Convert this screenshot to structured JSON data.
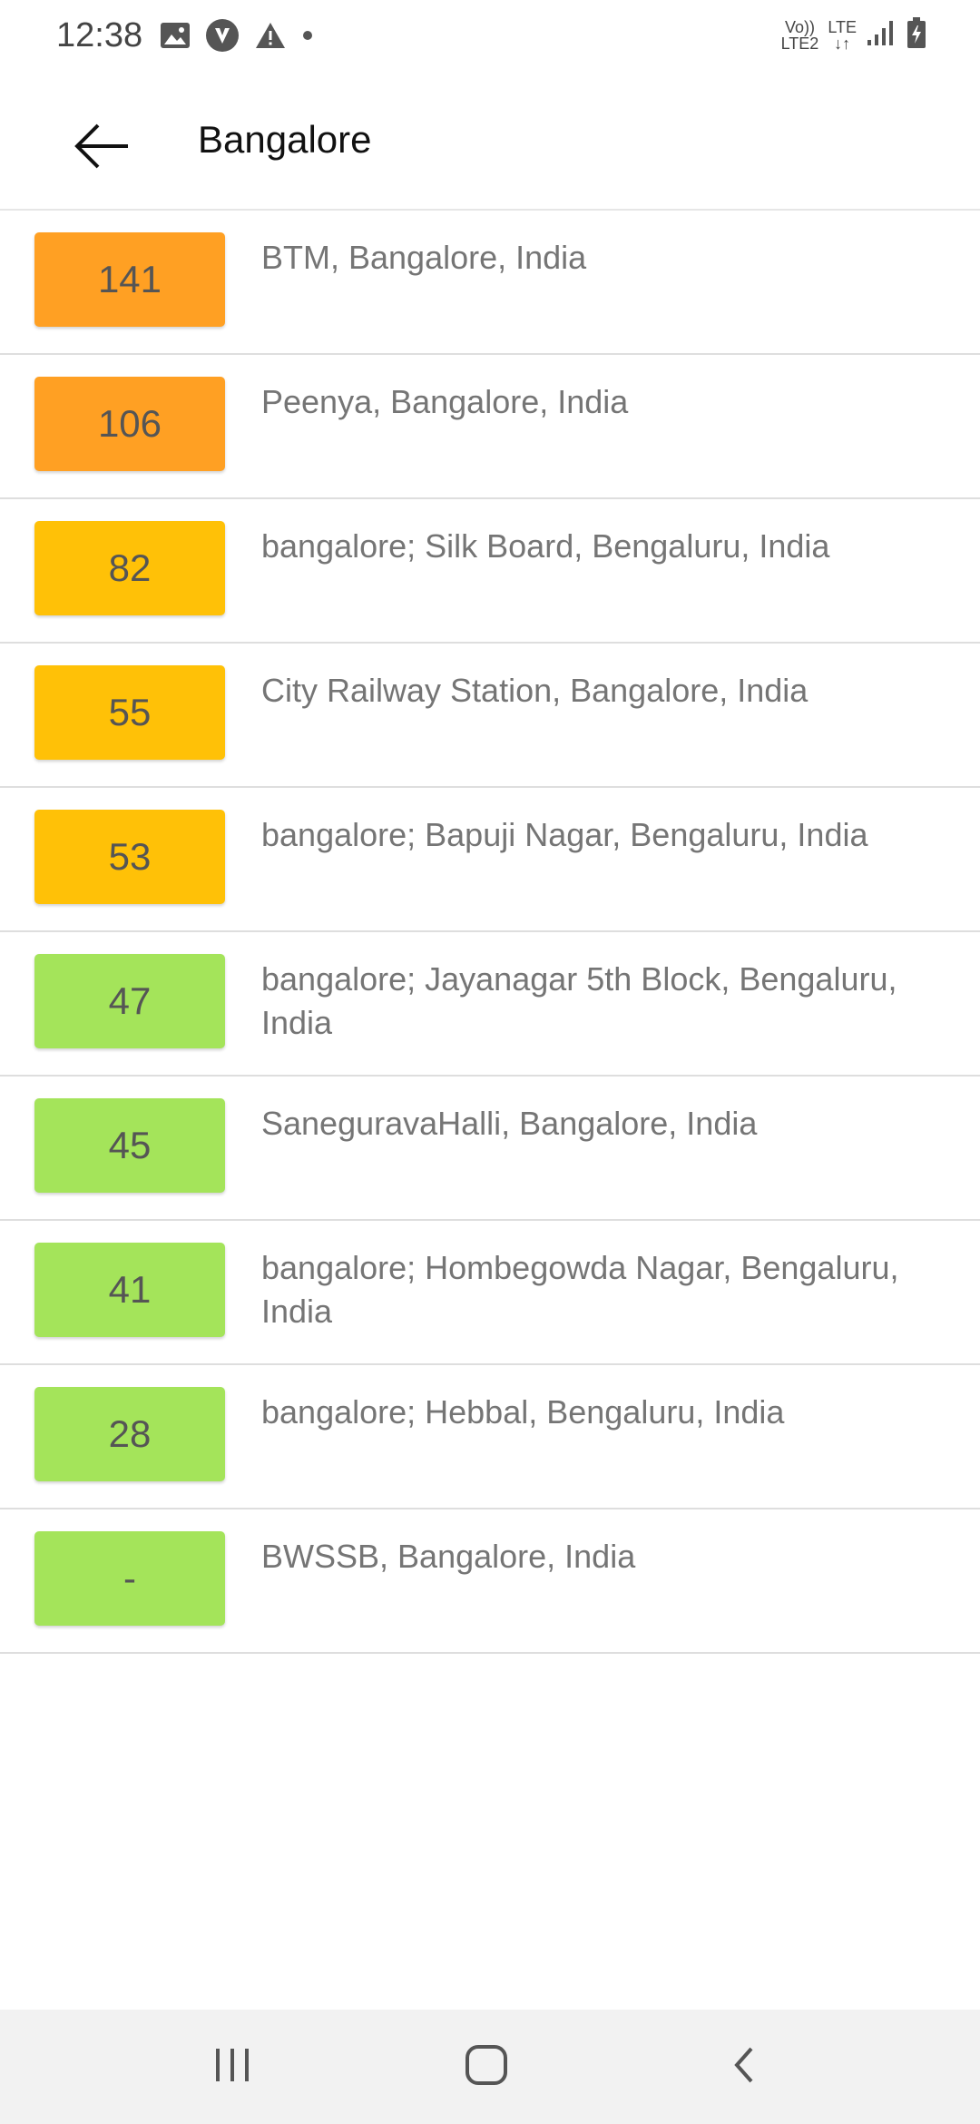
{
  "status_bar": {
    "time": "12:38",
    "left_icons": [
      "image-icon",
      "brand-icon",
      "warning-icon",
      "dot-icon"
    ],
    "volte_top": "Vo))",
    "volte_bottom": "LTE2",
    "lte_top": "LTE",
    "lte_bottom": "↓↑",
    "right_icons": [
      "signal-icon",
      "battery-charging-icon"
    ]
  },
  "app_bar": {
    "title": "Bangalore",
    "back_icon": "arrow-left-icon"
  },
  "colors": {
    "orange": "#FFA023",
    "amber": "#FFC107",
    "green": "#A4E45A"
  },
  "stations": [
    {
      "aqi": "141",
      "name": "BTM, Bangalore, India",
      "color": "#FFA023"
    },
    {
      "aqi": "106",
      "name": "Peenya, Bangalore, India",
      "color": "#FFA023"
    },
    {
      "aqi": "82",
      "name": "bangalore; Silk Board, Bengaluru, India",
      "color": "#FFC107"
    },
    {
      "aqi": "55",
      "name": "City Railway Station, Bangalore, India",
      "color": "#FFC107"
    },
    {
      "aqi": "53",
      "name": "bangalore; Bapuji Nagar, Bengaluru, India",
      "color": "#FFC107"
    },
    {
      "aqi": "47",
      "name": "bangalore; Jayanagar 5th Block, Bengaluru, India",
      "color": "#A4E45A"
    },
    {
      "aqi": "45",
      "name": "SaneguravaHalli, Bangalore, India",
      "color": "#A4E45A"
    },
    {
      "aqi": "41",
      "name": "bangalore; Hombegowda Nagar, Bengaluru, India",
      "color": "#A4E45A"
    },
    {
      "aqi": "28",
      "name": "bangalore; Hebbal, Bengaluru, India",
      "color": "#A4E45A"
    },
    {
      "aqi": "-",
      "name": "BWSSB, Bangalore, India",
      "color": "#A4E45A"
    }
  ],
  "nav_bar": {
    "buttons": [
      "recent-apps-icon",
      "home-icon",
      "back-icon"
    ]
  }
}
